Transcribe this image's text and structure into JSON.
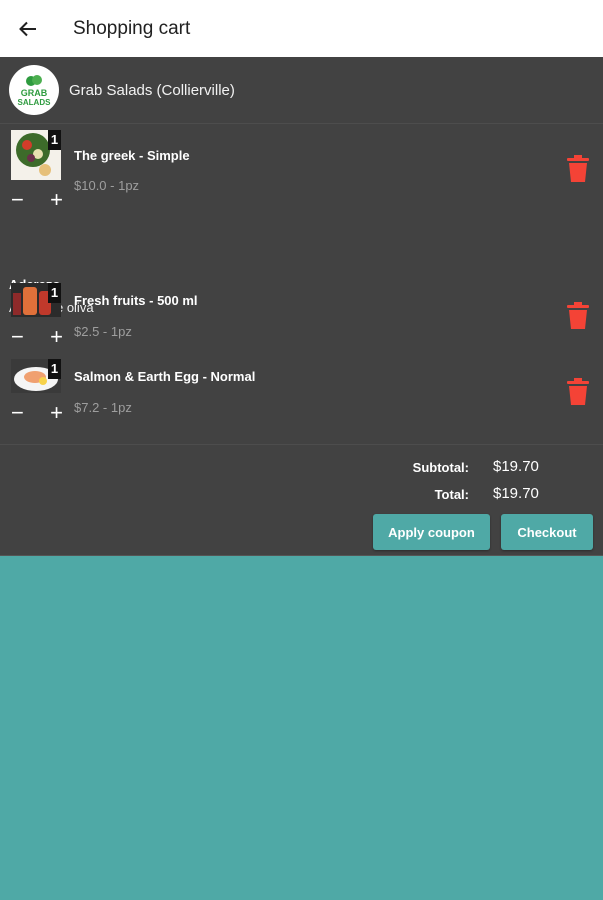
{
  "header": {
    "title": "Shopping cart"
  },
  "store": {
    "name": "Grab Salads (Collierville)",
    "logo_line1": "GRAB",
    "logo_line2": "SALADS"
  },
  "items": [
    {
      "name": "The greek - Simple",
      "price": "$10.0 - 1pz",
      "qty": "1",
      "option_title": "Aderezo",
      "option_value": "Aceite de oliva"
    },
    {
      "name": "Fresh fruits - 500 ml",
      "price": "$2.5 - 1pz",
      "qty": "1"
    },
    {
      "name": "Salmon & Earth Egg - Normal",
      "price": "$7.2 - 1pz",
      "qty": "1"
    }
  ],
  "stepper": {
    "minus": "−",
    "plus": "+"
  },
  "summary": {
    "subtotal_label": "Subtotal:",
    "subtotal_value": "$19.70",
    "total_label": "Total:",
    "total_value": "$19.70"
  },
  "buttons": {
    "apply_coupon": "Apply coupon",
    "checkout": "Checkout"
  },
  "colors": {
    "accent": "#4fa9a6",
    "card": "#424242",
    "delete": "#f44336",
    "logo_green": "#2e9b3f"
  }
}
